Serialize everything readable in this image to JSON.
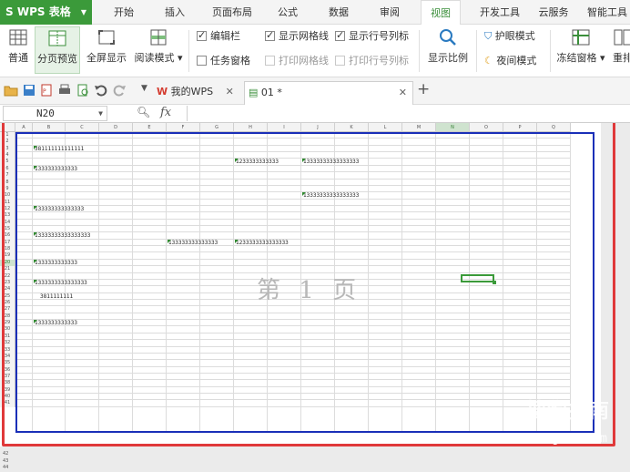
{
  "app": {
    "name": "WPS 表格"
  },
  "menu_tabs": [
    "开始",
    "插入",
    "页面布局",
    "公式",
    "数据",
    "审阅",
    "视图",
    "开发工具",
    "云服务",
    "智能工具"
  ],
  "ribbon": {
    "normal": "普通",
    "page_break_preview": "分页预览",
    "full_screen": "全屏显示",
    "reading_mode": "阅读模式",
    "edit_bar": "编辑栏",
    "task_pane": "任务窗格",
    "show_gridlines": "显示网格线",
    "print_gridlines": "打印网格线",
    "show_headings": "显示行号列标",
    "print_headings": "打印行号列标",
    "zoom": "显示比例",
    "eye_protection": "护眼模式",
    "night_mode": "夜间模式",
    "freeze_panes": "冻结窗格",
    "rearrange": "重排"
  },
  "tabs": {
    "mywps": "我的WPS",
    "doc": "01 *"
  },
  "formula_bar": {
    "name_box": "N20",
    "fx": "fx"
  },
  "columns": [
    "A",
    "B",
    "C",
    "D",
    "E",
    "F",
    "G",
    "H",
    "I",
    "J",
    "K",
    "L",
    "M",
    "N",
    "O",
    "P",
    "Q"
  ],
  "rows": [
    "1",
    "2",
    "3",
    "4",
    "5",
    "6",
    "7",
    "8",
    "9",
    "10",
    "11",
    "12",
    "13",
    "14",
    "15",
    "16",
    "17",
    "18",
    "19",
    "20",
    "21",
    "22",
    "23",
    "24",
    "25",
    "26",
    "27",
    "28",
    "29",
    "30",
    "31",
    "32",
    "33",
    "34",
    "35",
    "36",
    "37",
    "38",
    "39",
    "40",
    "41",
    "42",
    "43",
    "44"
  ],
  "cells": [
    {
      "ref": "B3",
      "text": "381111111111111"
    },
    {
      "ref": "H5",
      "text": "1233333333333"
    },
    {
      "ref": "J5",
      "text": "13333333333333333"
    },
    {
      "ref": "B6",
      "text": "1333333333333"
    },
    {
      "ref": "J10",
      "text": "13333333333333333"
    },
    {
      "ref": "B12",
      "text": "133333333333333"
    },
    {
      "ref": "B16",
      "text": "13333333333333333"
    },
    {
      "ref": "F17",
      "text": "133333333333333"
    },
    {
      "ref": "H17",
      "text": "1233333333333333"
    },
    {
      "ref": "B20",
      "text": "1333333333333"
    },
    {
      "ref": "B23",
      "text": "1333333333333333"
    },
    {
      "ref": "B25",
      "text": "3811111111"
    },
    {
      "ref": "B29",
      "text": "1333333333333"
    }
  ],
  "page_label": "第 1 页",
  "watermark": {
    "logo": "搜狗指南",
    "url": "zhinan.sogou.com"
  },
  "colors": {
    "accent": "#3b9a3a",
    "page_border": "#1a2fb8",
    "highlight": "#e0393a"
  }
}
